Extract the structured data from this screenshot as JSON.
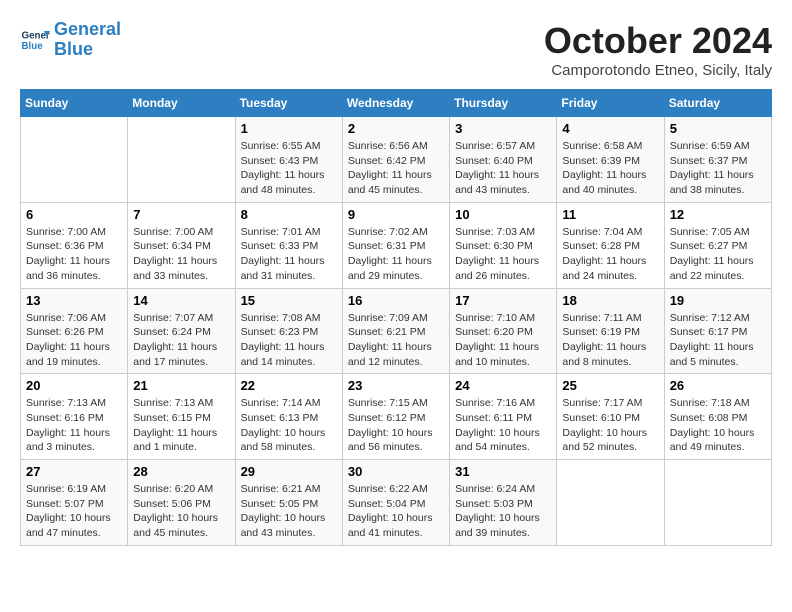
{
  "header": {
    "logo_line1": "General",
    "logo_line2": "Blue",
    "month_title": "October 2024",
    "location": "Camporotondo Etneo, Sicily, Italy"
  },
  "columns": [
    "Sunday",
    "Monday",
    "Tuesday",
    "Wednesday",
    "Thursday",
    "Friday",
    "Saturday"
  ],
  "weeks": [
    [
      {
        "day": "",
        "info": ""
      },
      {
        "day": "",
        "info": ""
      },
      {
        "day": "1",
        "info": "Sunrise: 6:55 AM\nSunset: 6:43 PM\nDaylight: 11 hours and 48 minutes."
      },
      {
        "day": "2",
        "info": "Sunrise: 6:56 AM\nSunset: 6:42 PM\nDaylight: 11 hours and 45 minutes."
      },
      {
        "day": "3",
        "info": "Sunrise: 6:57 AM\nSunset: 6:40 PM\nDaylight: 11 hours and 43 minutes."
      },
      {
        "day": "4",
        "info": "Sunrise: 6:58 AM\nSunset: 6:39 PM\nDaylight: 11 hours and 40 minutes."
      },
      {
        "day": "5",
        "info": "Sunrise: 6:59 AM\nSunset: 6:37 PM\nDaylight: 11 hours and 38 minutes."
      }
    ],
    [
      {
        "day": "6",
        "info": "Sunrise: 7:00 AM\nSunset: 6:36 PM\nDaylight: 11 hours and 36 minutes."
      },
      {
        "day": "7",
        "info": "Sunrise: 7:00 AM\nSunset: 6:34 PM\nDaylight: 11 hours and 33 minutes."
      },
      {
        "day": "8",
        "info": "Sunrise: 7:01 AM\nSunset: 6:33 PM\nDaylight: 11 hours and 31 minutes."
      },
      {
        "day": "9",
        "info": "Sunrise: 7:02 AM\nSunset: 6:31 PM\nDaylight: 11 hours and 29 minutes."
      },
      {
        "day": "10",
        "info": "Sunrise: 7:03 AM\nSunset: 6:30 PM\nDaylight: 11 hours and 26 minutes."
      },
      {
        "day": "11",
        "info": "Sunrise: 7:04 AM\nSunset: 6:28 PM\nDaylight: 11 hours and 24 minutes."
      },
      {
        "day": "12",
        "info": "Sunrise: 7:05 AM\nSunset: 6:27 PM\nDaylight: 11 hours and 22 minutes."
      }
    ],
    [
      {
        "day": "13",
        "info": "Sunrise: 7:06 AM\nSunset: 6:26 PM\nDaylight: 11 hours and 19 minutes."
      },
      {
        "day": "14",
        "info": "Sunrise: 7:07 AM\nSunset: 6:24 PM\nDaylight: 11 hours and 17 minutes."
      },
      {
        "day": "15",
        "info": "Sunrise: 7:08 AM\nSunset: 6:23 PM\nDaylight: 11 hours and 14 minutes."
      },
      {
        "day": "16",
        "info": "Sunrise: 7:09 AM\nSunset: 6:21 PM\nDaylight: 11 hours and 12 minutes."
      },
      {
        "day": "17",
        "info": "Sunrise: 7:10 AM\nSunset: 6:20 PM\nDaylight: 11 hours and 10 minutes."
      },
      {
        "day": "18",
        "info": "Sunrise: 7:11 AM\nSunset: 6:19 PM\nDaylight: 11 hours and 8 minutes."
      },
      {
        "day": "19",
        "info": "Sunrise: 7:12 AM\nSunset: 6:17 PM\nDaylight: 11 hours and 5 minutes."
      }
    ],
    [
      {
        "day": "20",
        "info": "Sunrise: 7:13 AM\nSunset: 6:16 PM\nDaylight: 11 hours and 3 minutes."
      },
      {
        "day": "21",
        "info": "Sunrise: 7:13 AM\nSunset: 6:15 PM\nDaylight: 11 hours and 1 minute."
      },
      {
        "day": "22",
        "info": "Sunrise: 7:14 AM\nSunset: 6:13 PM\nDaylight: 10 hours and 58 minutes."
      },
      {
        "day": "23",
        "info": "Sunrise: 7:15 AM\nSunset: 6:12 PM\nDaylight: 10 hours and 56 minutes."
      },
      {
        "day": "24",
        "info": "Sunrise: 7:16 AM\nSunset: 6:11 PM\nDaylight: 10 hours and 54 minutes."
      },
      {
        "day": "25",
        "info": "Sunrise: 7:17 AM\nSunset: 6:10 PM\nDaylight: 10 hours and 52 minutes."
      },
      {
        "day": "26",
        "info": "Sunrise: 7:18 AM\nSunset: 6:08 PM\nDaylight: 10 hours and 49 minutes."
      }
    ],
    [
      {
        "day": "27",
        "info": "Sunrise: 6:19 AM\nSunset: 5:07 PM\nDaylight: 10 hours and 47 minutes."
      },
      {
        "day": "28",
        "info": "Sunrise: 6:20 AM\nSunset: 5:06 PM\nDaylight: 10 hours and 45 minutes."
      },
      {
        "day": "29",
        "info": "Sunrise: 6:21 AM\nSunset: 5:05 PM\nDaylight: 10 hours and 43 minutes."
      },
      {
        "day": "30",
        "info": "Sunrise: 6:22 AM\nSunset: 5:04 PM\nDaylight: 10 hours and 41 minutes."
      },
      {
        "day": "31",
        "info": "Sunrise: 6:24 AM\nSunset: 5:03 PM\nDaylight: 10 hours and 39 minutes."
      },
      {
        "day": "",
        "info": ""
      },
      {
        "day": "",
        "info": ""
      }
    ]
  ]
}
